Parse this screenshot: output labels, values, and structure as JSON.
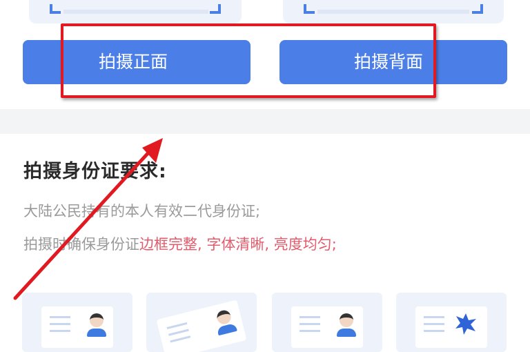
{
  "capture": {
    "front_button_label": "拍摄正面",
    "back_button_label": "拍摄背面"
  },
  "requirements": {
    "title": "拍摄身份证要求:",
    "line1": "大陆公民持有的本人有效二代身份证;",
    "line2_prefix": "拍摄时确保身份证",
    "line2_highlight": "边框完整, 字体清晰, 亮度均匀;"
  },
  "colors": {
    "accent": "#4b7ee6",
    "annotation": "#e11a22",
    "highlight_text": "#e35a6b"
  },
  "example_cards": [
    "standard-example-icon",
    "tilted-example-icon",
    "standard-example-icon",
    "obscured-example-icon"
  ]
}
